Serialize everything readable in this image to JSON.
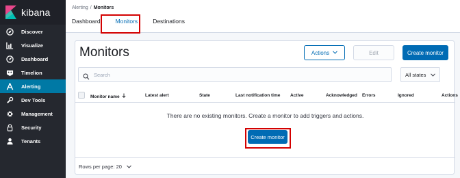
{
  "app": {
    "name": "kibana"
  },
  "sidebar": {
    "items": [
      {
        "label": "Discover",
        "icon": "compass-icon"
      },
      {
        "label": "Visualize",
        "icon": "bar-chart-icon"
      },
      {
        "label": "Dashboard",
        "icon": "dashboard-icon"
      },
      {
        "label": "Timelion",
        "icon": "timelion-icon"
      },
      {
        "label": "Alerting",
        "icon": "alerting-icon",
        "active": true
      },
      {
        "label": "Dev Tools",
        "icon": "wrench-icon"
      },
      {
        "label": "Management",
        "icon": "gear-icon"
      },
      {
        "label": "Security",
        "icon": "lock-icon"
      },
      {
        "label": "Tenants",
        "icon": "user-icon"
      }
    ]
  },
  "header": {
    "breadcrumb": {
      "parent": "Alerting",
      "separator": "/",
      "current": "Monitors"
    },
    "tabs": [
      {
        "label": "Dashboard"
      },
      {
        "label": "Monitors",
        "active": true
      },
      {
        "label": "Destinations"
      }
    ]
  },
  "panel": {
    "title": "Monitors",
    "actions_label": "Actions",
    "edit_label": "Edit",
    "create_label": "Create monitor",
    "search_placeholder": "Search",
    "state_filter": "All states",
    "columns": [
      "Monitor name",
      "Latest alert",
      "State",
      "Last notification time",
      "Active",
      "Acknowledged",
      "Errors",
      "Ignored",
      "Actions"
    ],
    "empty_message": "There are no existing monitors. Create a monitor to add triggers and actions.",
    "empty_create_label": "Create monitor",
    "rows_per_page": "Rows per page: 20"
  },
  "colors": {
    "sidebar": "#25282f",
    "accent": "#006bb4",
    "active_nav": "#0079a5",
    "highlight": "#d30000"
  }
}
